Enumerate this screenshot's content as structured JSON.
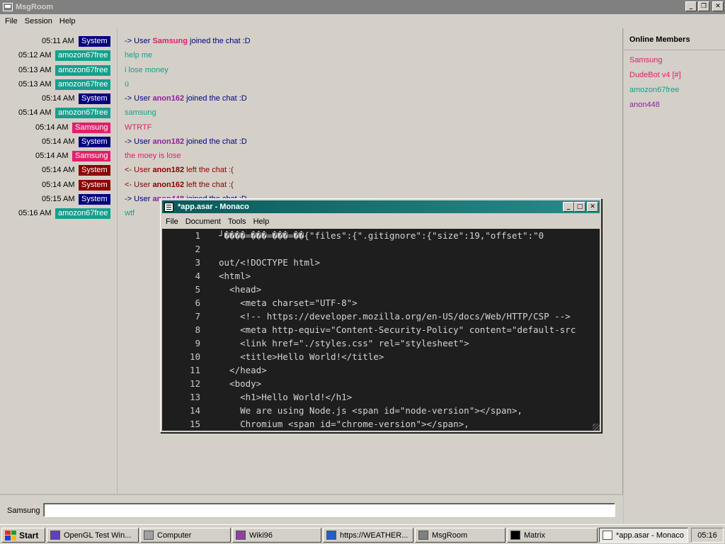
{
  "window": {
    "title": "MsgRoom"
  },
  "menu": [
    "File",
    "Session",
    "Help"
  ],
  "messages": [
    {
      "time": "05:11 AM",
      "user": "System",
      "user_color": "#000080",
      "parts": [
        {
          "t": "-> User ",
          "b": false
        },
        {
          "t": "Samsung",
          "b": true,
          "c": "#e0206a"
        },
        {
          "t": " joined the chat :D",
          "b": false
        }
      ],
      "msg_color": "#000080"
    },
    {
      "time": "05:12 AM",
      "user": "amozon67free",
      "user_color": "#14a08c",
      "parts": [
        {
          "t": "help me",
          "b": false
        }
      ],
      "msg_color": "#14a08c"
    },
    {
      "time": "05:13 AM",
      "user": "amozon67free",
      "user_color": "#14a08c",
      "parts": [
        {
          "t": "i lose money",
          "b": false
        }
      ],
      "msg_color": "#14a08c"
    },
    {
      "time": "05:13 AM",
      "user": "amozon67free",
      "user_color": "#14a08c",
      "parts": [
        {
          "t": "ü",
          "b": false
        }
      ],
      "msg_color": "#14a08c"
    },
    {
      "time": "05:14 AM",
      "user": "System",
      "user_color": "#000080",
      "parts": [
        {
          "t": "-> User ",
          "b": false
        },
        {
          "t": "anon162",
          "b": true,
          "c": "#9020a0"
        },
        {
          "t": " joined the chat :D",
          "b": false
        }
      ],
      "msg_color": "#000080"
    },
    {
      "time": "05:14 AM",
      "user": "amozon67free",
      "user_color": "#14a08c",
      "parts": [
        {
          "t": "samsung",
          "b": false
        }
      ],
      "msg_color": "#14a08c"
    },
    {
      "time": "05:14 AM",
      "user": "Samsung",
      "user_color": "#e0206a",
      "parts": [
        {
          "t": "WTRTF",
          "b": false
        }
      ],
      "msg_color": "#e0206a"
    },
    {
      "time": "05:14 AM",
      "user": "System",
      "user_color": "#000080",
      "parts": [
        {
          "t": "-> User ",
          "b": false
        },
        {
          "t": "anon182",
          "b": true,
          "c": "#9020a0"
        },
        {
          "t": " joined the chat :D",
          "b": false
        }
      ],
      "msg_color": "#000080"
    },
    {
      "time": "05:14 AM",
      "user": "Samsung",
      "user_color": "#e0206a",
      "parts": [
        {
          "t": "the moey is lose",
          "b": false
        }
      ],
      "msg_color": "#e0206a"
    },
    {
      "time": "05:14 AM",
      "user": "System",
      "user_color": "#8b0000",
      "parts": [
        {
          "t": "<- User ",
          "b": false
        },
        {
          "t": "anon182",
          "b": true,
          "c": "#8b0000"
        },
        {
          "t": " left the chat :(",
          "b": false
        }
      ],
      "msg_color": "#8b0000"
    },
    {
      "time": "05:14 AM",
      "user": "System",
      "user_color": "#8b0000",
      "parts": [
        {
          "t": "<- User ",
          "b": false
        },
        {
          "t": "anon162",
          "b": true,
          "c": "#8b0000"
        },
        {
          "t": " left the chat :(",
          "b": false
        }
      ],
      "msg_color": "#8b0000"
    },
    {
      "time": "05:15 AM",
      "user": "System",
      "user_color": "#000080",
      "parts": [
        {
          "t": "-> User ",
          "b": false
        },
        {
          "t": "anon448",
          "b": true,
          "c": "#9020a0"
        },
        {
          "t": " joined the chat :D",
          "b": false
        }
      ],
      "msg_color": "#000080"
    },
    {
      "time": "05:16 AM",
      "user": "amozon67free",
      "user_color": "#14a08c",
      "parts": [
        {
          "t": "wtf",
          "b": false
        }
      ],
      "msg_color": "#14a08c"
    }
  ],
  "members": {
    "title": "Online Members",
    "list": [
      {
        "name": "Samsung",
        "color": "#e0206a"
      },
      {
        "name": "DudeBot v4 [#]",
        "color": "#e0206a"
      },
      {
        "name": "amozon67free",
        "color": "#14a08c"
      },
      {
        "name": "anon448",
        "color": "#9020a0"
      }
    ]
  },
  "input": {
    "label": "Samsung",
    "value": ""
  },
  "editor": {
    "title": "*app.asar - Monaco",
    "menu": [
      "File",
      "Document",
      "Tools",
      "Help"
    ],
    "lines": [
      {
        "n": "1",
        "code": "┘����=���=���=��{\"files\":{\".gitignore\":{\"size\":19,\"offset\":\"0"
      },
      {
        "n": "2",
        "code": ""
      },
      {
        "n": "3",
        "code": "out/<!DOCTYPE html>"
      },
      {
        "n": "4",
        "code": "<html>"
      },
      {
        "n": "5",
        "code": "  <head>"
      },
      {
        "n": "6",
        "code": "    <meta charset=\"UTF-8\">"
      },
      {
        "n": "7",
        "code": "    <!-- https://developer.mozilla.org/en-US/docs/Web/HTTP/CSP -->"
      },
      {
        "n": "8",
        "code": "    <meta http-equiv=\"Content-Security-Policy\" content=\"default-src"
      },
      {
        "n": "9",
        "code": "    <link href=\"./styles.css\" rel=\"stylesheet\">"
      },
      {
        "n": "10",
        "code": "    <title>Hello World!</title>"
      },
      {
        "n": "11",
        "code": "  </head>"
      },
      {
        "n": "12",
        "code": "  <body>"
      },
      {
        "n": "13",
        "code": "    <h1>Hello World!</h1>"
      },
      {
        "n": "14",
        "code": "    We are using Node.js <span id=\"node-version\"></span>,"
      },
      {
        "n": "15",
        "code": "    Chromium <span id=\"chrome-version\"></span>,"
      }
    ]
  },
  "taskbar": {
    "start": "Start",
    "buttons": [
      {
        "label": "OpenGL Test Win...",
        "icon_color": "#6040c0",
        "active": false
      },
      {
        "label": "Computer",
        "icon_color": "#a0a0a0",
        "active": false
      },
      {
        "label": "Wiki96",
        "icon_color": "#9040a0",
        "active": false
      },
      {
        "label": "https://WEATHER...",
        "icon_color": "#2060c0",
        "active": false
      },
      {
        "label": "MsgRoom",
        "icon_color": "#808080",
        "active": false
      },
      {
        "label": "Matrix",
        "icon_color": "#000000",
        "active": false
      },
      {
        "label": "*app.asar - Monaco",
        "icon_color": "#ffffff",
        "active": true
      }
    ],
    "clock": "05:16"
  }
}
